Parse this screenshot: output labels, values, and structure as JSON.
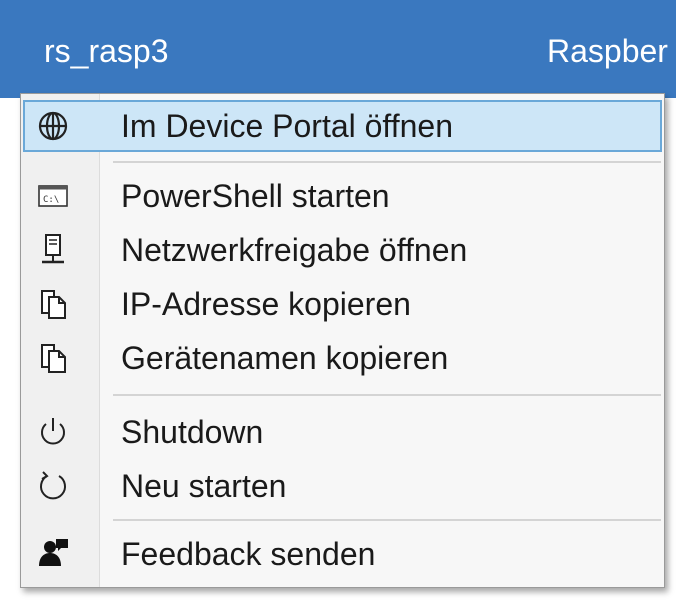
{
  "header": {
    "device_name": "rs_rasp3",
    "device_type": "Raspber"
  },
  "menu": {
    "items": [
      {
        "id": "open-device-portal",
        "label": "Im Device Portal öffnen",
        "icon": "globe-icon",
        "highlighted": true
      },
      {
        "id": "start-powershell",
        "label": "PowerShell starten",
        "icon": "console-icon"
      },
      {
        "id": "open-network-share",
        "label": "Netzwerkfreigabe öffnen",
        "icon": "network-share-icon"
      },
      {
        "id": "copy-ip-address",
        "label": "IP-Adresse kopieren",
        "icon": "copy-icon"
      },
      {
        "id": "copy-device-name",
        "label": "Gerätenamen kopieren",
        "icon": "copy-icon"
      },
      {
        "id": "shutdown",
        "label": "Shutdown",
        "icon": "power-icon"
      },
      {
        "id": "restart",
        "label": "Neu starten",
        "icon": "restart-icon"
      },
      {
        "id": "send-feedback",
        "label": "Feedback senden",
        "icon": "feedback-icon"
      }
    ]
  },
  "colors": {
    "header_bg": "#3a78bf",
    "highlight_bg": "#cde6f7",
    "highlight_border": "#6aa8d8"
  }
}
